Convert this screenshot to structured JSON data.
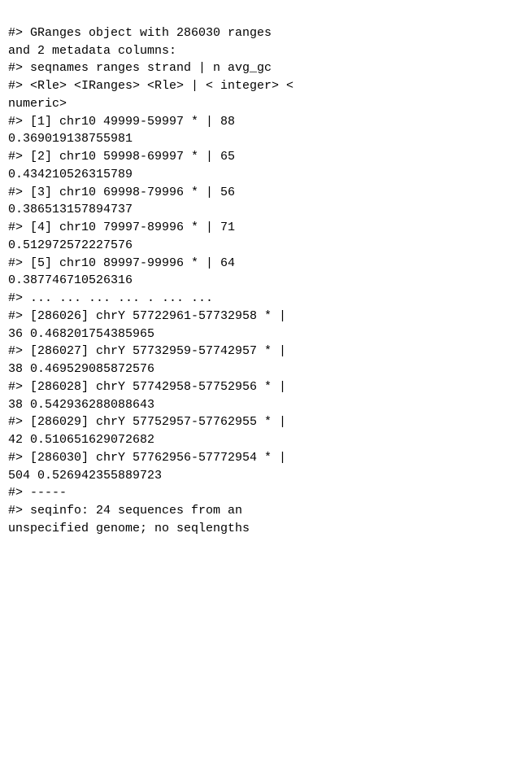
{
  "console": {
    "lines": [
      "#> GRanges object with 286030 ranges",
      "and 2 metadata columns:",
      "#> seqnames ranges strand | n avg_gc",
      "#> <Rle> <IRanges> <Rle> | < integer> <",
      "numeric>",
      "",
      "#> [1] chr10 49999-59997 * | 88",
      "0.369019138755981",
      "#> [2] chr10 59998-69997 * | 65",
      "0.434210526315789",
      "#> [3] chr10 69998-79996 * | 56",
      "0.386513157894737",
      "#> [4] chr10 79997-89996 * | 71",
      "0.512972572227576",
      "#> [5] chr10 89997-99996 * | 64",
      "0.387746710526316",
      "#> ... ... ... ... . ... ...",
      "#> [286026] chrY 57722961-57732958 * |",
      "36 0.468201754385965",
      "#> [286027] chrY 57732959-57742957 * |",
      "38 0.469529085872576",
      "#> [286028] chrY 57742958-57752956 * |",
      "38 0.542936288088643",
      "#> [286029] chrY 57752957-57762955 * |",
      "42 0.510651629072682",
      "#> [286030] chrY 57762956-57772954 * |",
      "504 0.526942355889723",
      "#> -----",
      "#> seqinfo: 24 sequences from an",
      "unspecified genome; no seqlengths"
    ]
  }
}
